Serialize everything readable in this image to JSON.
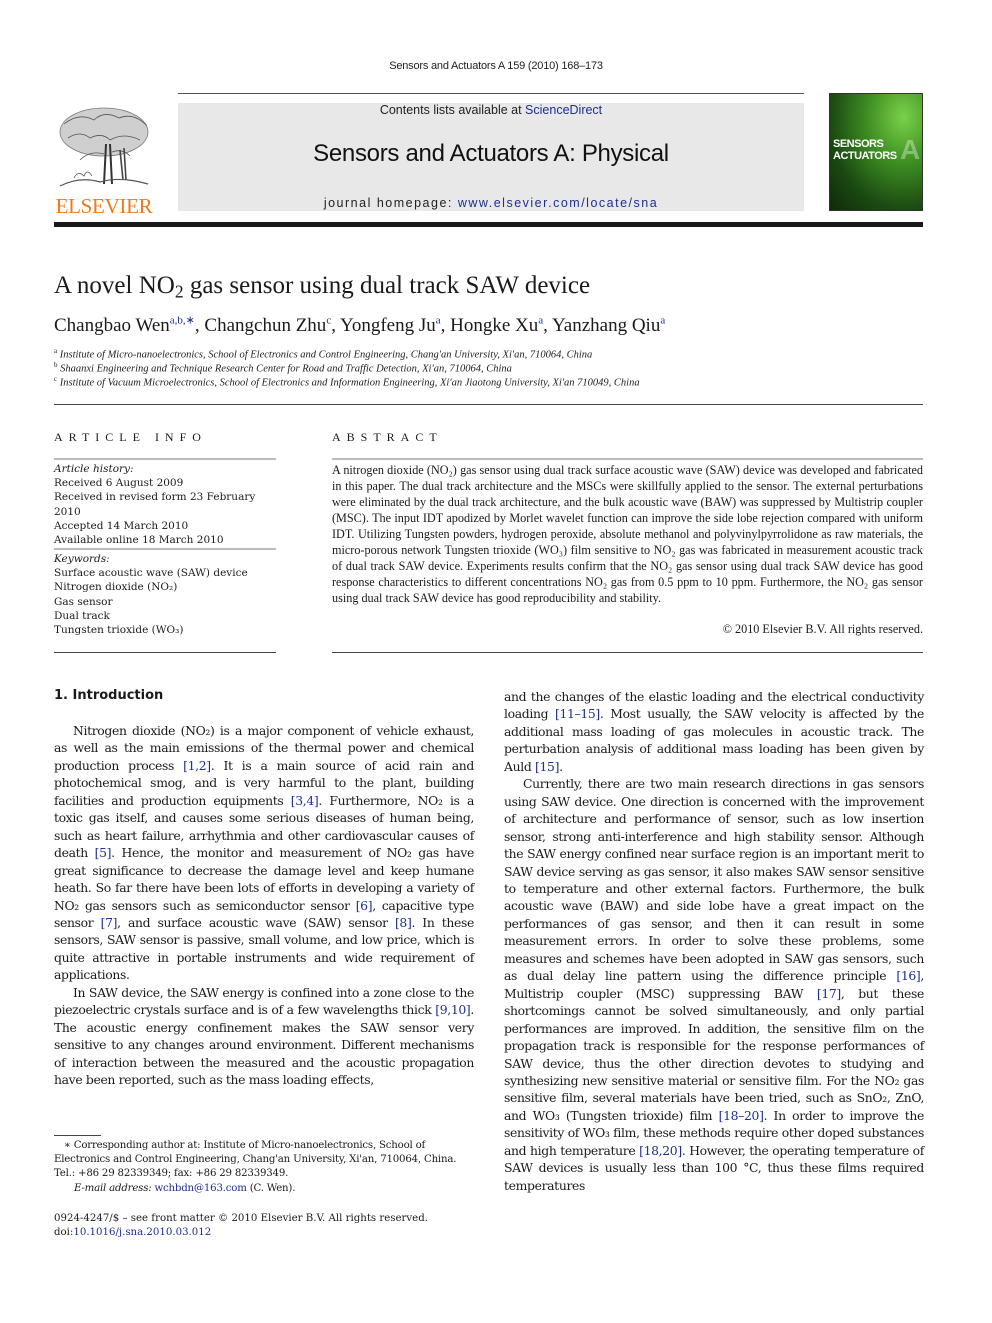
{
  "running_head": "Sensors and Actuators A 159 (2010) 168–173",
  "masthead": {
    "publisher_logo_text": "ELSEVIER",
    "contents_prefix": "Contents lists available at ",
    "contents_link": "ScienceDirect",
    "journal_name": "Sensors and Actuators A: Physical",
    "homepage_prefix": "journal homepage: ",
    "homepage_link": "www.elsevier.com/locate/sna",
    "cover": {
      "line1": "SENSORS",
      "line2": "ACTUATORS",
      "letter": "A"
    },
    "colors": {
      "publisher_orange": "#f07a1a",
      "link_blue": "#1e2f8f",
      "masthead_grey": "#e8e8e8"
    }
  },
  "article": {
    "title_pre": "A novel NO",
    "title_sub": "2",
    "title_post": " gas sensor using dual track SAW device",
    "authors": [
      {
        "name": "Changbao Wen",
        "sup": "a,b,∗",
        "sep": ", "
      },
      {
        "name": "Changchun Zhu",
        "sup": "c",
        "sep": ", "
      },
      {
        "name": "Yongfeng Ju",
        "sup": "a",
        "sep": ", "
      },
      {
        "name": "Hongke Xu",
        "sup": "a",
        "sep": ", "
      },
      {
        "name": "Yanzhang Qiu",
        "sup": "a",
        "sep": ""
      }
    ],
    "affiliations": [
      {
        "mark": "a",
        "text": "Institute of Micro-nanoelectronics, School of Electronics and Control Engineering, Chang'an University, Xi'an, 710064, China"
      },
      {
        "mark": "b",
        "text": "Shaanxi Engineering and Technique Research Center for Road and Traffic Detection, Xi'an, 710064, China"
      },
      {
        "mark": "c",
        "text": "Institute of Vacuum Microelectronics, School of Electronics and Information Engineering, Xi'an Jiaotong University, Xi'an 710049, China"
      }
    ]
  },
  "article_info": {
    "heading": "ARTICLE INFO",
    "history_label": "Article history:",
    "history": [
      "Received 6 August 2009",
      "Received in revised form 23 February 2010",
      "Accepted 14 March 2010",
      "Available online 18 March 2010"
    ],
    "keywords_label": "Keywords:",
    "keywords": [
      "Surface acoustic wave (SAW) device",
      "Nitrogen dioxide (NO₂)",
      "Gas sensor",
      "Dual track",
      "Tungsten trioxide (WO₃)"
    ]
  },
  "abstract": {
    "heading": "ABSTRACT",
    "text": "A nitrogen dioxide (NO₂) gas sensor using dual track surface acoustic wave (SAW) device was developed and fabricated in this paper. The dual track architecture and the MSCs were skillfully applied to the sensor. The external perturbations were eliminated by the dual track architecture, and the bulk acoustic wave (BAW) was suppressed by Multistrip coupler (MSC). The input IDT apodized by Morlet wavelet function can improve the side lobe rejection compared with uniform IDT. Utilizing Tungsten powders, hydrogen peroxide, absolute methanol and polyvinylpyrrolidone as raw materials, the micro-porous network Tungsten trioxide (WO₃) film sensitive to NO₂ gas was fabricated in measurement acoustic track of dual track SAW device. Experiments results confirm that the NO₂ gas sensor using dual track SAW device has good response characteristics to different concentrations NO₂ gas from 0.5 ppm to 10 ppm. Furthermore, the NO₂ gas sensor using dual track SAW device has good reproducibility and stability.",
    "copyright": "© 2010 Elsevier B.V. All rights reserved."
  },
  "body": {
    "section_heading": "1.  Introduction",
    "left_paragraphs": [
      [
        {
          "t": "Nitrogen dioxide (NO₂) is a major component of vehicle exhaust, as well as the main emissions of the thermal power and chemical production process "
        },
        {
          "r": "[1,2]"
        },
        {
          "t": ". It is a main source of acid rain and photochemical smog, and is very harmful to the plant, building facilities and production equipments "
        },
        {
          "r": "[3,4]"
        },
        {
          "t": ". Furthermore, NO₂ is a toxic gas itself, and causes some serious diseases of human being, such as heart failure, arrhythmia and other cardiovascular causes of death "
        },
        {
          "r": "[5]"
        },
        {
          "t": ". Hence, the monitor and measurement of NO₂ gas have great significance to decrease the damage level and keep humane heath. So far there have been lots of efforts in developing a variety of NO₂ gas sensors such as semiconductor sensor "
        },
        {
          "r": "[6]"
        },
        {
          "t": ", capacitive type sensor "
        },
        {
          "r": "[7]"
        },
        {
          "t": ", and surface acoustic wave (SAW) sensor "
        },
        {
          "r": "[8]"
        },
        {
          "t": ". In these sensors, SAW sensor is passive, small volume, and low price, which is quite attractive in portable instruments and wide requirement of applications."
        }
      ],
      [
        {
          "t": "In SAW device, the SAW energy is confined into a zone close to the piezoelectric crystals surface and is of a few wavelengths thick "
        },
        {
          "r": "[9,10]"
        },
        {
          "t": ". The acoustic energy confinement makes the SAW sensor very sensitive to any changes around environment. Different mechanisms of interaction between the measured and the acoustic propagation have been reported, such as the mass loading effects,"
        }
      ]
    ],
    "right_paragraphs": [
      [
        {
          "t": "and the changes of the elastic loading and the electrical conductivity loading "
        },
        {
          "r": "[11–15]"
        },
        {
          "t": ". Most usually, the SAW velocity is affected by the additional mass loading of gas molecules in acoustic track. The perturbation analysis of additional mass loading has been given by Auld "
        },
        {
          "r": "[15]"
        },
        {
          "t": "."
        }
      ],
      [
        {
          "t": "Currently, there are two main research directions in gas sensors using SAW device. One direction is concerned with the improvement of architecture and performance of sensor, such as low insertion sensor, strong anti-interference and high stability sensor. Although the SAW energy confined near surface region is an important merit to SAW device serving as gas sensor, it also makes SAW sensor sensitive to temperature and other external factors. Furthermore, the bulk acoustic wave (BAW) and side lobe have a great impact on the performances of gas sensor, and then it can result in some measurement errors. In order to solve these problems, some measures and schemes have been adopted in SAW gas sensors, such as dual delay line pattern using the difference principle "
        },
        {
          "r": "[16]"
        },
        {
          "t": ", Multistrip coupler (MSC) suppressing BAW "
        },
        {
          "r": "[17]"
        },
        {
          "t": ", but these shortcomings cannot be solved simultaneously, and only partial performances are improved. In addition, the sensitive film on the propagation track is responsible for the response performances of SAW device, thus the other direction devotes to studying and synthesizing new sensitive material or sensitive film. For the NO₂ gas sensitive film, several materials have been tried, such as SnO₂, ZnO, and WO₃ (Tungsten trioxide) film "
        },
        {
          "r": "[18–20]"
        },
        {
          "t": ". In order to improve the sensitivity of WO₃ film, these methods require other doped substances and high temperature "
        },
        {
          "r": "[18,20]"
        },
        {
          "t": ". However, the operating temperature of SAW devices is usually less than 100 °C, thus these films required temperatures"
        }
      ]
    ]
  },
  "footnote": {
    "corresponding": "∗ Corresponding author at: Institute of Micro-nanoelectronics, School of Electronics and Control Engineering, Chang'an University, Xi'an, 710064, China.",
    "tel_fax": "Tel.: +86 29 82339349; fax: +86 29 82339349.",
    "email_label": "E-mail address: ",
    "email": "wchbdn@163.com",
    "email_suffix": " (C. Wen)."
  },
  "front_matter": {
    "issn_line": "0924-4247/$ – see front matter © 2010 Elsevier B.V. All rights reserved.",
    "doi_prefix": "doi:",
    "doi": "10.1016/j.sna.2010.03.012"
  }
}
